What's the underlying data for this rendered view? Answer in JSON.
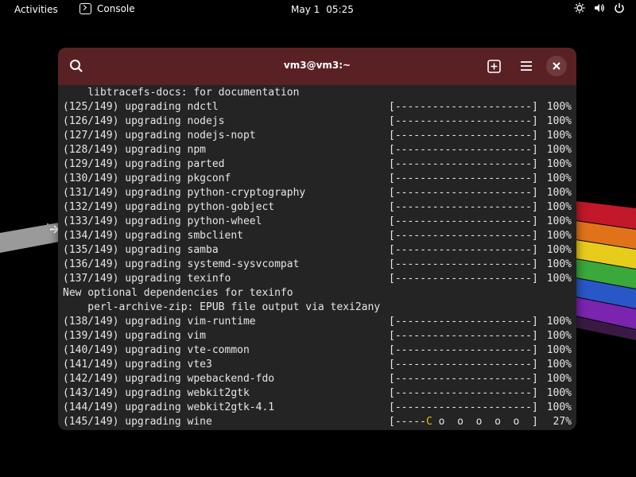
{
  "topbar": {
    "activities": "Activities",
    "app_name": "Console",
    "date": "May 1",
    "time": "05:25",
    "tray_icons": [
      "brightness-icon",
      "volume-icon",
      "power-icon"
    ]
  },
  "window": {
    "title": "vm3@vm3:~",
    "headerbar_color": "#5a2125"
  },
  "terminal": {
    "lines": [
      {
        "text": "    libtracefs-docs: for documentation"
      },
      {
        "text": "(125/149) upgrading ndctl",
        "bar": "[----------------------]",
        "pct": "100%"
      },
      {
        "text": "(126/149) upgrading nodejs",
        "bar": "[----------------------]",
        "pct": "100%"
      },
      {
        "text": "(127/149) upgrading nodejs-nopt",
        "bar": "[----------------------]",
        "pct": "100%"
      },
      {
        "text": "(128/149) upgrading npm",
        "bar": "[----------------------]",
        "pct": "100%"
      },
      {
        "text": "(129/149) upgrading parted",
        "bar": "[----------------------]",
        "pct": "100%"
      },
      {
        "text": "(130/149) upgrading pkgconf",
        "bar": "[----------------------]",
        "pct": "100%"
      },
      {
        "text": "(131/149) upgrading python-cryptography",
        "bar": "[----------------------]",
        "pct": "100%"
      },
      {
        "text": "(132/149) upgrading python-gobject",
        "bar": "[----------------------]",
        "pct": "100%"
      },
      {
        "text": "(133/149) upgrading python-wheel",
        "bar": "[----------------------]",
        "pct": "100%"
      },
      {
        "text": "(134/149) upgrading smbclient",
        "bar": "[----------------------]",
        "pct": "100%"
      },
      {
        "text": "(135/149) upgrading samba",
        "bar": "[----------------------]",
        "pct": "100%"
      },
      {
        "text": "(136/149) upgrading systemd-sysvcompat",
        "bar": "[----------------------]",
        "pct": "100%"
      },
      {
        "text": "(137/149) upgrading texinfo",
        "bar": "[----------------------]",
        "pct": "100%"
      },
      {
        "text": "New optional dependencies for texinfo"
      },
      {
        "text": "    perl-archive-zip: EPUB file output via texi2any"
      },
      {
        "text": "(138/149) upgrading vim-runtime",
        "bar": "[----------------------]",
        "pct": "100%"
      },
      {
        "text": "(139/149) upgrading vim",
        "bar": "[----------------------]",
        "pct": "100%"
      },
      {
        "text": "(140/149) upgrading vte-common",
        "bar": "[----------------------]",
        "pct": "100%"
      },
      {
        "text": "(141/149) upgrading vte3",
        "bar": "[----------------------]",
        "pct": "100%"
      },
      {
        "text": "(142/149) upgrading wpebackend-fdo",
        "bar": "[----------------------]",
        "pct": "100%"
      },
      {
        "text": "(143/149) upgrading webkit2gtk",
        "bar": "[----------------------]",
        "pct": "100%"
      },
      {
        "text": "(144/149) upgrading webkit2gtk-4.1",
        "bar": "[----------------------]",
        "pct": "100%"
      },
      {
        "text": "(145/149) upgrading wine",
        "bar_pre": "[-----",
        "bar_pac": "C",
        "bar_post": " o  o  o  o  o  ]",
        "pct": "27%"
      }
    ]
  }
}
